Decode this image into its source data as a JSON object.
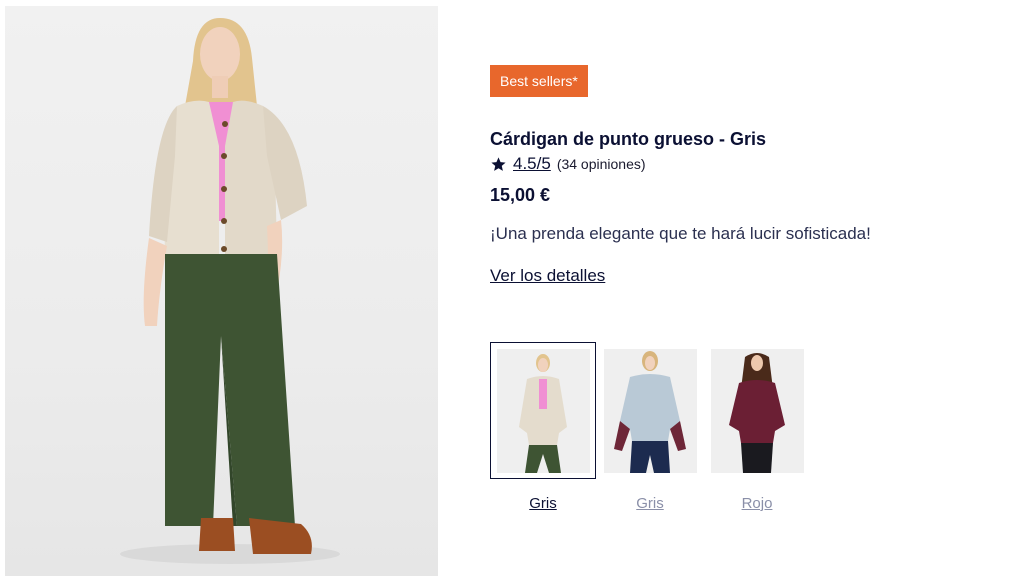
{
  "product": {
    "badge": "Best sellers*",
    "title": "Cárdigan de punto grueso - Gris",
    "rating": {
      "icon": "star-icon",
      "score": "4.5/5",
      "count": "(34 opiniones)"
    },
    "price": "15,00 €",
    "description": "¡Una prenda elegante que te hará lucir sofisticada!",
    "details_link": "Ver los detalles"
  },
  "variants": [
    {
      "label": "Gris",
      "selected": true
    },
    {
      "label": "Gris",
      "selected": false
    },
    {
      "label": "Rojo",
      "selected": false
    }
  ],
  "colors": {
    "badge": "#e8672c",
    "text_dark": "#0b1033",
    "variant_inactive": "#8a8fa8"
  }
}
